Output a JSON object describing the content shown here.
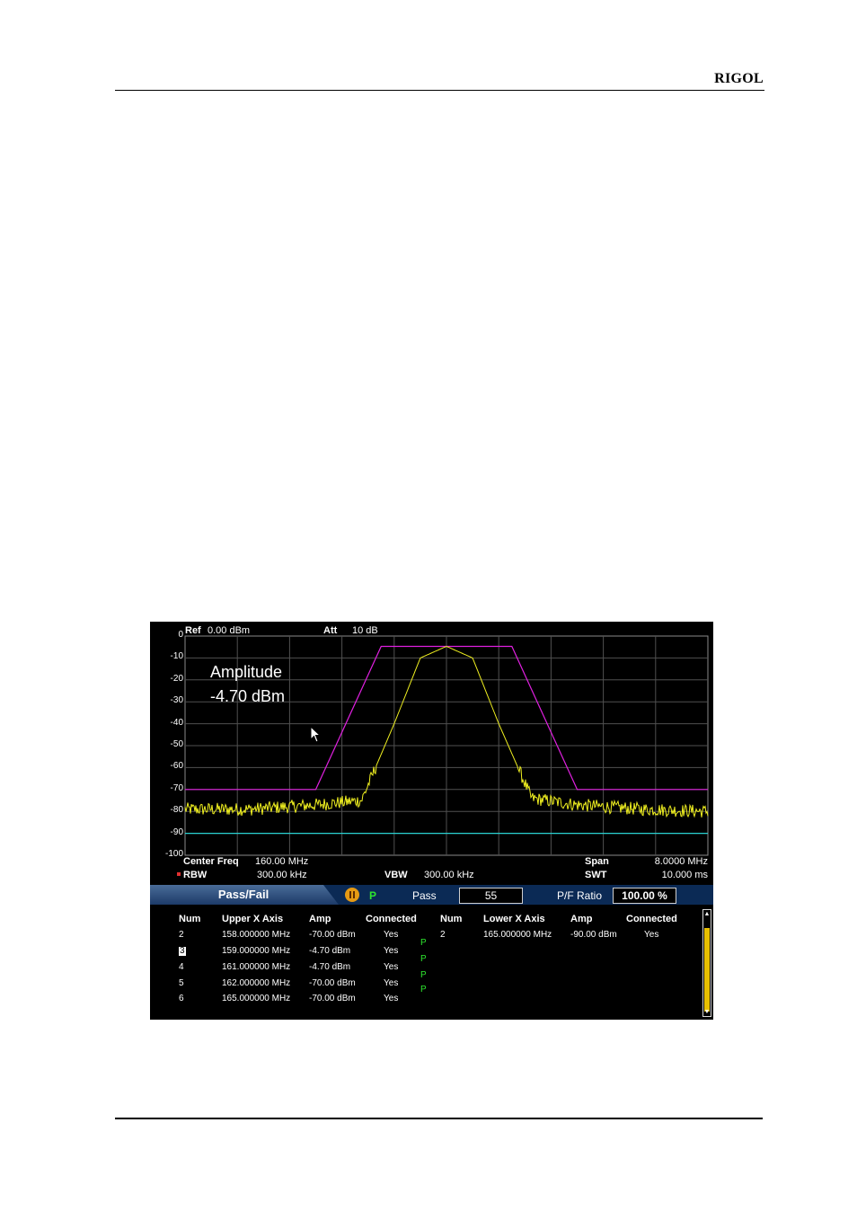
{
  "header": {
    "brand": "RIGOL"
  },
  "screen": {
    "ref_label": "Ref",
    "ref_value": "0.00 dBm",
    "att_label": "Att",
    "att_value": "10 dB",
    "y_ticks": [
      "0",
      "-10",
      "-20",
      "-30",
      "-40",
      "-50",
      "-60",
      "-70",
      "-80",
      "-90",
      "-100"
    ],
    "annotation": {
      "line1": "Amplitude",
      "line2": "-4.70 dBm"
    },
    "bottom": {
      "center_freq_label": "Center Freq",
      "center_freq_value": "160.00 MHz",
      "span_label": "Span",
      "span_value": "8.0000 MHz",
      "rbw_label": "RBW",
      "rbw_value": "300.00 kHz",
      "vbw_label": "VBW",
      "vbw_value": "300.00 kHz",
      "swt_label": "SWT",
      "swt_value": "10.000 ms"
    },
    "colors": {
      "upper_limit": "#e020e0",
      "lower_limit": "#28d0d0",
      "trace": "#f0f020",
      "grid": "#505050",
      "pass": "#2ee62e",
      "scrollbar": "#e8c000"
    }
  },
  "chart_data": {
    "type": "line",
    "x_unit": "MHz",
    "ylim": [
      -100,
      0
    ],
    "xlim": [
      156,
      164
    ],
    "grid": true,
    "series": [
      {
        "name": "Upper",
        "x": [
          156,
          158,
          159,
          161,
          162,
          164
        ],
        "y": [
          -70,
          -70,
          -4.7,
          -4.7,
          -70,
          -70
        ]
      },
      {
        "name": "Lower",
        "x": [
          156,
          164
        ],
        "y": [
          -90,
          -90
        ]
      },
      {
        "x": [
          156,
          157,
          158,
          158.7,
          159.2,
          159.6,
          160,
          160.4,
          160.8,
          161.3,
          162,
          163,
          164
        ],
        "y": [
          -79,
          -79,
          -77,
          -75,
          -40,
          -10,
          -4.7,
          -10,
          -40,
          -74,
          -77,
          -79,
          -80
        ]
      }
    ]
  },
  "passfail": {
    "title": "Pass/Fail",
    "status": "P",
    "pass_label": "Pass",
    "pass_value": "55",
    "ratio_label": "P/F Ratio",
    "ratio_value": "100.00 %",
    "upper_headers": [
      "Num",
      "Upper X Axis",
      "Amp",
      "Connected"
    ],
    "lower_headers": [
      "Num",
      "Lower X Axis",
      "Amp",
      "Connected"
    ],
    "upper_rows": [
      {
        "num": "2",
        "x": "158.000000 MHz",
        "amp": "-70.00 dBm",
        "connected": "Yes"
      },
      {
        "num": "3",
        "x": "159.000000 MHz",
        "amp": "-4.70 dBm",
        "connected": "Yes"
      },
      {
        "num": "4",
        "x": "161.000000 MHz",
        "amp": "-4.70 dBm",
        "connected": "Yes"
      },
      {
        "num": "5",
        "x": "162.000000 MHz",
        "amp": "-70.00 dBm",
        "connected": "Yes"
      },
      {
        "num": "6",
        "x": "165.000000 MHz",
        "amp": "-70.00 dBm",
        "connected": "Yes"
      }
    ],
    "segment_marks": [
      "P",
      "P",
      "P",
      "P"
    ],
    "lower_rows": [
      {
        "num": "2",
        "x": "165.000000 MHz",
        "amp": "-90.00 dBm",
        "connected": "Yes"
      }
    ]
  }
}
